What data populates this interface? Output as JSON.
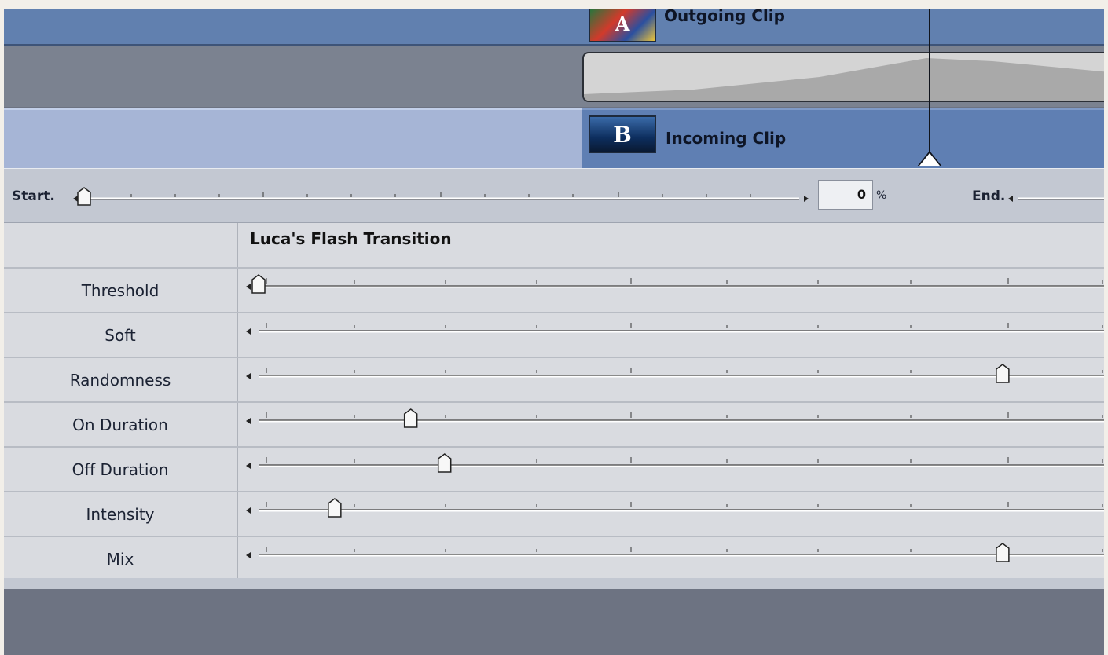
{
  "tracks": {
    "outgoing_label": "Outgoing Clip",
    "outgoing_thumb_letter": "A",
    "incoming_label": "Incoming Clip",
    "incoming_thumb_letter": "B"
  },
  "timebar": {
    "start_label": "Start",
    "end_label": "End",
    "percent_value": "0",
    "percent_symbol": "%"
  },
  "effect": {
    "title": "Luca's Flash Transition",
    "parameters": [
      {
        "label": "Threshold",
        "value": 0.0
      },
      {
        "label": "Soft",
        "value": null
      },
      {
        "label": "Randomness",
        "value": 0.88
      },
      {
        "label": "On Duration",
        "value": 0.18
      },
      {
        "label": "Off Duration",
        "value": 0.22
      },
      {
        "label": "Intensity",
        "value": 0.09
      },
      {
        "label": "Mix",
        "value": 0.88
      }
    ]
  },
  "colors": {
    "outgoing_track": "#6180af",
    "incoming_track": "#5f7fb3",
    "panel": "#d9dbe0"
  }
}
